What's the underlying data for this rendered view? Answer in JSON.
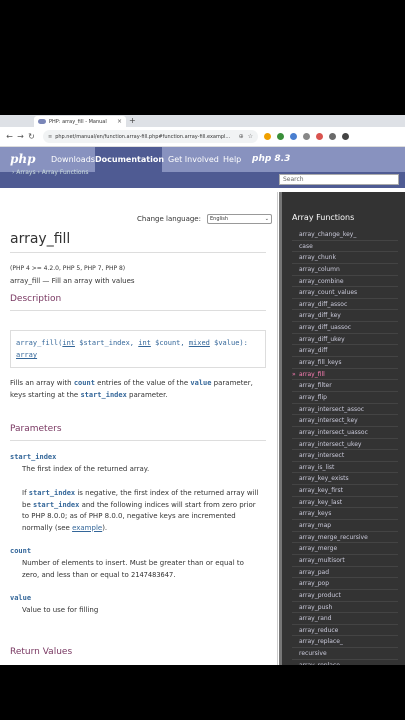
{
  "browser": {
    "tab_title": "PHP: array_fill - Manual",
    "tab_close": "×",
    "new_tab": "+",
    "url": "php.net/manual/en/function.array-fill.php#function.array-fill.exampl...",
    "back": "←",
    "forward": "→",
    "reload": "↻"
  },
  "nav": {
    "logo": "php",
    "links": [
      "Downloads",
      "Documentation",
      "Get Involved",
      "Help"
    ],
    "php_version": "php 8.3",
    "breadcrumb": "› Arrays   › Array Functions",
    "search_placeholder": "Search"
  },
  "main": {
    "change_language": "Change language:",
    "language": "English",
    "title": "array_fill",
    "versions": "(PHP 4 >= 4.2.0, PHP 5, PHP 7, PHP 8)",
    "refpurpose": "array_fill — Fill an array with values",
    "description_heading": "Description",
    "synopsis": {
      "fn": "array_fill(",
      "p1_type": "int",
      "p1_name": " $start_index, ",
      "p2_type": "int",
      "p2_name": " $count, ",
      "p3_type": "mixed",
      "p3_name": " $value",
      "close": "):",
      "ret": "array"
    },
    "desc_para": {
      "a": "Fills an array with ",
      "count": "count",
      "b": " entries of the value of the ",
      "value": "value",
      "c": " parameter, keys starting at the ",
      "start_index": "start_index",
      "d": " parameter."
    },
    "parameters_heading": "Parameters",
    "params": {
      "start_index": {
        "term": "start_index",
        "desc1": "The first index of the returned array.",
        "p2a": "If ",
        "p2b": "start_index",
        "p2c": " is negative, the first index of the returned array will be ",
        "p2d": "start_index",
        "p2e": " and the following indices will start from zero prior to PHP 8.0.0; as of PHP 8.0.0, negative keys are incremented normally (see ",
        "p2link": "example",
        "p2f": ")."
      },
      "count": {
        "term": "count",
        "desc_a": "Number of elements to insert. Must be greater than or equal to zero, and less than or equal to ",
        "desc_num": "2147483647",
        "desc_b": "."
      },
      "value": {
        "term": "value",
        "desc": "Value to use for filling"
      }
    },
    "return_heading": "Return Values"
  },
  "sidebar": {
    "title": "Array Functions",
    "items": [
      "array_change_key_",
      "case",
      "array_chunk",
      "array_column",
      "array_combine",
      "array_count_values",
      "array_diff_assoc",
      "array_diff_key",
      "array_diff_uassoc",
      "array_diff_ukey",
      "array_diff",
      "array_fill_keys",
      "array_fill",
      "array_filter",
      "array_flip",
      "array_intersect_assoc",
      "array_intersect_key",
      "array_intersect_uassoc",
      "array_intersect_ukey",
      "array_intersect",
      "array_is_list",
      "array_key_exists",
      "array_key_first",
      "array_key_last",
      "array_keys",
      "array_map",
      "array_merge_recursive",
      "array_merge",
      "array_multisort",
      "array_pad",
      "array_pop",
      "array_product",
      "array_push",
      "array_rand",
      "array_reduce",
      "array_replace_",
      "recursive",
      "array_replace"
    ],
    "current_index": 12
  },
  "colors": {
    "php_header": "#8892bf",
    "php_dark": "#4f5b93",
    "heading": "#793862",
    "code": "#369",
    "sidebar_bg": "#333333",
    "current": "#ff7eb6"
  }
}
